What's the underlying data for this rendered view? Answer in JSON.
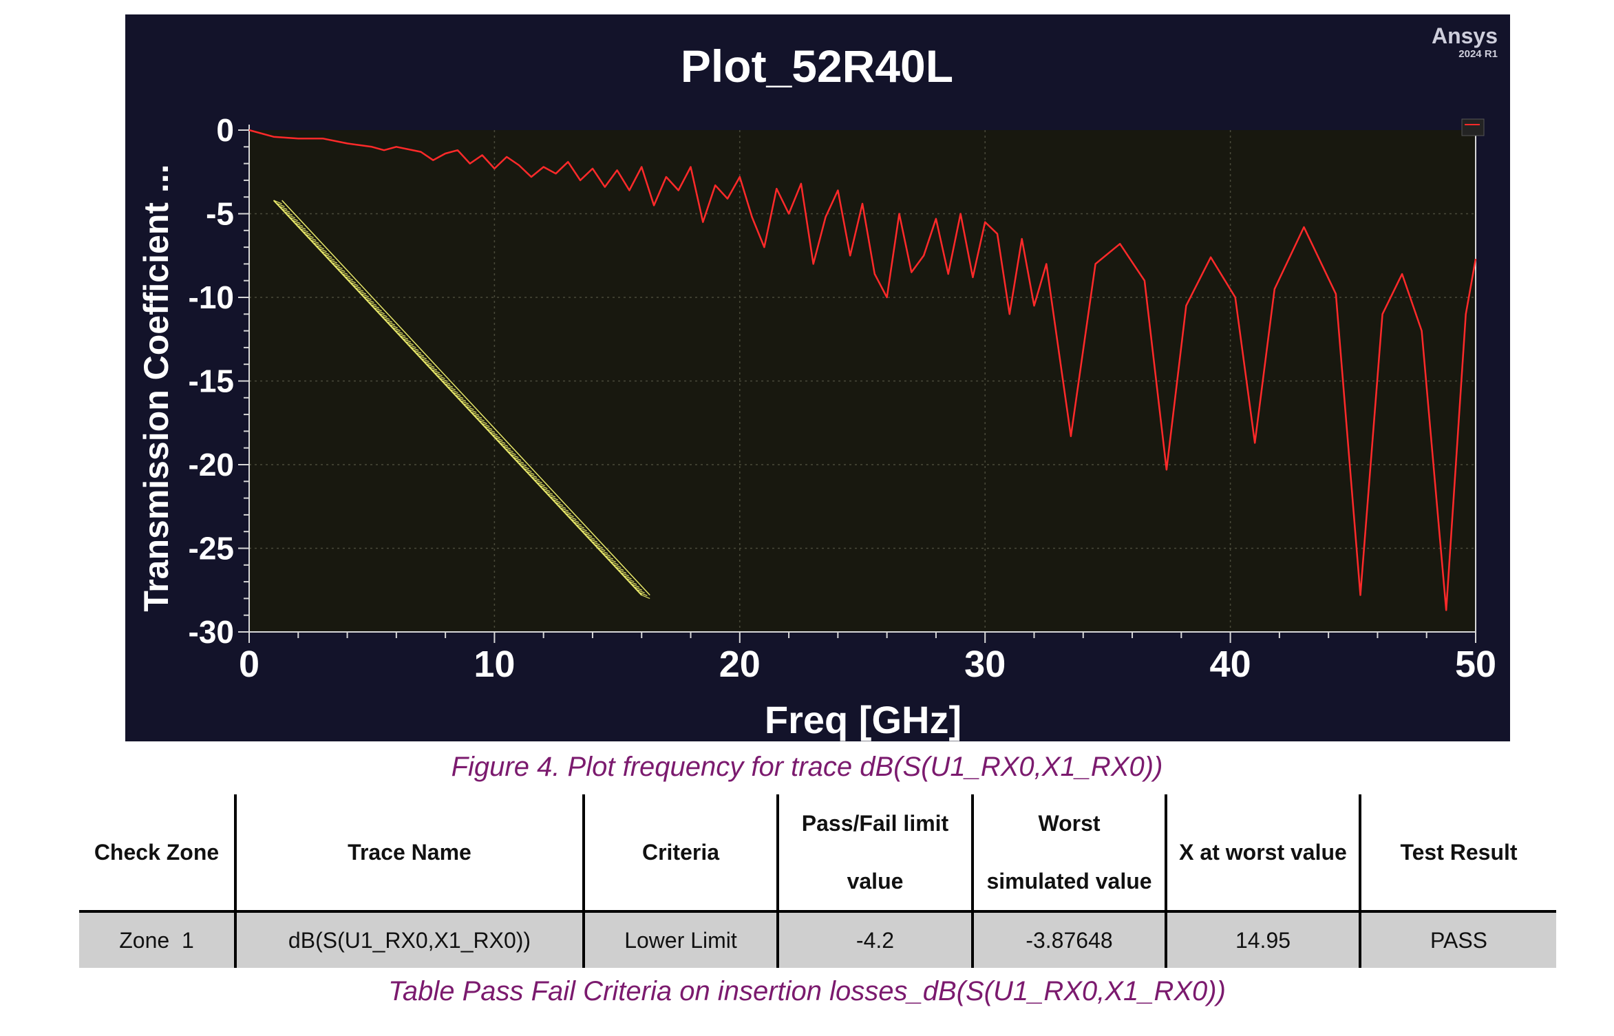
{
  "chart_data": {
    "type": "line",
    "title": "Plot_52R40L",
    "brand": {
      "name": "Ansys",
      "version": "2024 R1"
    },
    "xlabel": "Freq [GHz]",
    "ylabel": "Transmission Coefficient ...",
    "xlim": [
      0,
      50
    ],
    "ylim": [
      -30,
      0
    ],
    "xticks": [
      0,
      10,
      20,
      30,
      40,
      50
    ],
    "yticks": [
      0,
      -5,
      -10,
      -15,
      -20,
      -25,
      -30
    ],
    "grid": true,
    "legend": "top-right",
    "colors": {
      "background": "#13132a",
      "plot_area": "#18180f",
      "trace": "#ff2a2a",
      "limit": "#e8e86a",
      "text": "#ffffff"
    },
    "series": [
      {
        "name": "",
        "color": "#ff2a2a",
        "x": [
          0,
          1,
          2,
          3,
          4,
          5,
          5.5,
          6,
          7,
          7.5,
          8,
          8.5,
          9,
          9.5,
          10,
          10.5,
          11,
          11.5,
          12,
          12.5,
          13,
          13.5,
          14,
          14.5,
          15,
          15.5,
          16,
          16.5,
          17,
          17.5,
          18,
          18.5,
          19,
          19.5,
          20,
          20.5,
          21,
          21.5,
          22,
          22.5,
          23,
          23.5,
          24,
          24.5,
          25,
          25.5,
          26,
          26.5,
          27,
          27.5,
          28,
          28.5,
          29,
          29.5,
          30,
          30.5,
          31,
          31.5,
          32,
          32.5,
          33.5,
          34.5,
          35.5,
          36.5,
          37.4,
          38.2,
          39.2,
          40.2,
          41,
          41.8,
          43,
          44.3,
          45.3,
          46.2,
          47,
          47.8,
          48.8,
          49.6,
          50
        ],
        "y": [
          0,
          -0.4,
          -0.5,
          -0.5,
          -0.8,
          -1.0,
          -1.2,
          -1.0,
          -1.3,
          -1.8,
          -1.4,
          -1.2,
          -2.0,
          -1.5,
          -2.3,
          -1.6,
          -2.1,
          -2.8,
          -2.2,
          -2.6,
          -1.9,
          -3.0,
          -2.3,
          -3.4,
          -2.4,
          -3.6,
          -2.2,
          -4.5,
          -2.8,
          -3.6,
          -2.2,
          -5.5,
          -3.3,
          -4.1,
          -2.8,
          -5.2,
          -7.0,
          -3.5,
          -5.0,
          -3.2,
          -8.0,
          -5.2,
          -3.6,
          -7.5,
          -4.4,
          -8.6,
          -10.0,
          -5.0,
          -8.5,
          -7.5,
          -5.3,
          -8.6,
          -5.0,
          -8.8,
          -5.5,
          -6.2,
          -11.0,
          -6.5,
          -10.5,
          -8.0,
          -18.3,
          -8.0,
          -6.8,
          -9.0,
          -20.3,
          -10.5,
          -7.6,
          -10.0,
          -18.7,
          -9.5,
          -5.8,
          -9.8,
          -27.8,
          -11.0,
          -8.6,
          -12.0,
          -28.7,
          -11.0,
          -7.7
        ]
      }
    ],
    "limit_line": {
      "name": "Lower Limit",
      "x": [
        1,
        16
      ],
      "y": [
        -4.2,
        -27.8
      ],
      "color": "#e8e86a"
    }
  },
  "figure_caption": "Figure 4. Plot frequency for trace dB(S(U1_RX0,X1_RX0))",
  "table": {
    "headers": {
      "check_zone": "Check Zone",
      "trace_name": "Trace Name",
      "criteria": "Criteria",
      "limit_line1": "Pass/Fail limit",
      "limit_line2": "value",
      "worst_line1": "Worst",
      "worst_line2": "simulated value",
      "x_worst": "X at worst value",
      "result": "Test Result"
    },
    "row": {
      "check_zone": "Zone  1",
      "trace_name": "dB(S(U1_RX0,X1_RX0))",
      "criteria": "Lower Limit",
      "limit_value": "-4.2",
      "worst_value": "-3.87648",
      "x_worst": "14.95",
      "result": "PASS"
    }
  },
  "table_caption": "Table Pass Fail Criteria on insertion losses_dB(S(U1_RX0,X1_RX0))"
}
